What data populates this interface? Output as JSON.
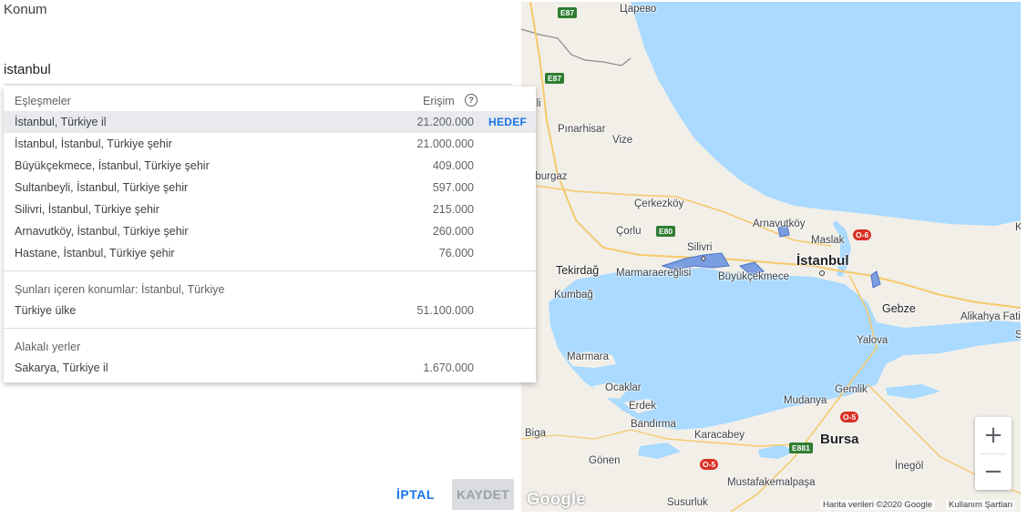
{
  "field_label": "Konum",
  "search": {
    "value": "istanbul"
  },
  "dropdown": {
    "header": {
      "matches": "Eşleşmeler",
      "reach": "Erişim",
      "help": "?"
    },
    "results": [
      {
        "name": "İstanbul, Türkiye il",
        "reach": "21.200.000",
        "target": "HEDEF"
      },
      {
        "name": "İstanbul, İstanbul, Türkiye şehir",
        "reach": "21.000.000"
      },
      {
        "name": "Büyükçekmece, İstanbul, Türkiye şehir",
        "reach": "409.000"
      },
      {
        "name": "Sultanbeyli, İstanbul, Türkiye şehir",
        "reach": "597.000"
      },
      {
        "name": "Silivri, İstanbul, Türkiye şehir",
        "reach": "215.000"
      },
      {
        "name": "Arnavutköy, İstanbul, Türkiye şehir",
        "reach": "260.000"
      },
      {
        "name": "Hastane, İstanbul, Türkiye şehir",
        "reach": "76.000"
      }
    ],
    "containing": {
      "title": "Şunları içeren konumlar: İstanbul, Türkiye",
      "items": [
        {
          "name": "Türkiye ülke",
          "reach": "51.100.000"
        }
      ]
    },
    "related": {
      "title": "Alakalı yerler",
      "items": [
        {
          "name": "Sakarya, Türkiye il",
          "reach": "1.670.000"
        }
      ]
    }
  },
  "buttons": {
    "cancel": "İPTAL",
    "save": "KAYDET"
  },
  "map": {
    "places": {
      "hapevo": "Царево",
      "ucareli": "areli",
      "pinarhisar": "Pınarhisar",
      "vize": "Vize",
      "luleburgaz": "üleburgaz",
      "cerkezkoy": "Çerkezköy",
      "corlu": "Çorlu",
      "arnavutkoy": "Arnavutköy",
      "maslak": "Maslak",
      "silivri": "Silivri",
      "istanbul": "İstanbul",
      "tekirdag": "Tekirdağ",
      "marmaraereglisi": "Marmaraereğlisi",
      "buyukcekmece": "Büyükçekmece",
      "kumbag": "Kumbağ",
      "gebze": "Gebze",
      "alikahya": "Alikahya Fatih",
      "yalova": "Yalova",
      "marmara": "Marmara",
      "ocaklar": "Ocaklar",
      "erdek": "Erdek",
      "gemlik": "Gemlik",
      "mudanya": "Mudanya",
      "bandirma": "Bandırma",
      "biga": "Biga",
      "karacabey": "Karacabey",
      "bursa": "Bursa",
      "gonen": "Gönen",
      "inegol": "İnegöl",
      "mustafakemalpasa": "Mustafakemalpaşa",
      "susurluk": "Susurluk",
      "ki": "Ki",
      "se": "Se"
    },
    "shields": {
      "e87a": "E87",
      "e87b": "E87",
      "e80": "E80",
      "o6": "O-6",
      "o5a": "O-5",
      "o5b": "O-5",
      "e881": "E881"
    },
    "colors": {
      "water": "#aadaff",
      "land": "#f2efe9",
      "highlight": "#7b9ee0"
    },
    "zoom_in": "+",
    "zoom_out": "−",
    "google": "Google",
    "attribution": "Harita verileri ©2020 Google",
    "terms": "Kullanım Şartları"
  }
}
